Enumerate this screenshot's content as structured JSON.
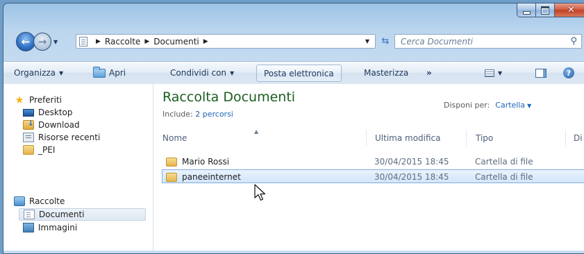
{
  "window": {
    "caption_buttons": [
      "minimize",
      "maximize",
      "close"
    ]
  },
  "nav": {
    "back": "back-arrow",
    "forward": "forward-arrow",
    "address": {
      "crumbs": [
        "Raccolte",
        "Documenti"
      ]
    },
    "search_placeholder": "Cerca Documenti"
  },
  "toolbar": {
    "organize": "Organizza",
    "open": "Apri",
    "share": "Condividi con",
    "email": "Posta elettronica",
    "burn": "Masterizza",
    "more": "»"
  },
  "sidebar": {
    "favorites": "Preferiti",
    "desktop": "Desktop",
    "download": "Download",
    "recent": "Risorse recenti",
    "pei": "_PEI",
    "libraries": "Raccolte",
    "documents": "Documenti",
    "images": "Immagini"
  },
  "library": {
    "title": "Raccolta Documenti",
    "include_label": "Include:",
    "include_link": "2 percorsi",
    "arrange_label": "Disponi per:",
    "arrange_value": "Cartella"
  },
  "columns": {
    "name": "Nome",
    "modified": "Ultima modifica",
    "type": "Tipo",
    "size": "Di"
  },
  "files": [
    {
      "name": "Mario Rossi",
      "modified": "30/04/2015 18:45",
      "type": "Cartella di file"
    },
    {
      "name": "paneeinternet",
      "modified": "30/04/2015 18:45",
      "type": "Cartella di file"
    }
  ],
  "colors": {
    "title_green": "#1a5d1f",
    "link_blue": "#1e64b8",
    "selection": "#d2e6fb"
  }
}
